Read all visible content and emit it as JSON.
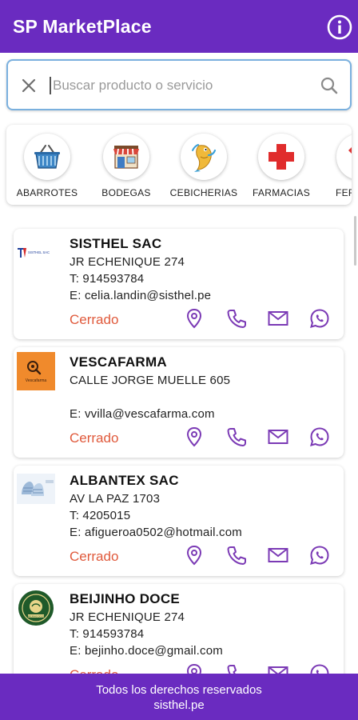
{
  "app": {
    "title": "SP MarketPlace"
  },
  "colors": {
    "primary": "#6a2bc0",
    "status_closed": "#e05a3c",
    "action_icon": "#7b3ab5",
    "search_border": "#7ab0de"
  },
  "search": {
    "placeholder": "Buscar producto o servicio",
    "value": ""
  },
  "categories": [
    {
      "label": "ABARROTES",
      "icon": "shopping-basket-icon"
    },
    {
      "label": "BODEGAS",
      "icon": "storefront-icon"
    },
    {
      "label": "CEBICHERIAS",
      "icon": "fish-icon"
    },
    {
      "label": "FARMACIAS",
      "icon": "red-cross-icon"
    },
    {
      "label": "FERR",
      "icon": "hardware-icon"
    }
  ],
  "businesses": [
    {
      "name": "SISTHEL SAC",
      "address": "JR ECHENIQUE 274",
      "phone": "T: 914593784",
      "email": "E: celia.landin@sisthel.pe",
      "status": "Cerrado",
      "logo_text": "SISTHEL SAC"
    },
    {
      "name": "VESCAFARMA",
      "address": "CALLE JORGE MUELLE 605",
      "phone": "",
      "email": "E: vvilla@vescafarma.com",
      "status": "Cerrado",
      "logo_text": "Vescafarma"
    },
    {
      "name": "ALBANTEX SAC",
      "address": "AV LA PAZ 1703",
      "phone": "T: 4205015",
      "email": "E: afigueroa0502@hotmail.com",
      "status": "Cerrado",
      "logo_text": ""
    },
    {
      "name": "BEIJINHO DOCE",
      "address": "JR ECHENIQUE 274",
      "phone": "T: 914593784",
      "email": "E: bejinho.doce@gmail.com",
      "status": "Cerrado",
      "logo_text": "BEIJINHO DOCE"
    }
  ],
  "footer": {
    "line1": "Todos los derechos reservados",
    "line2": "sisthel.pe"
  }
}
